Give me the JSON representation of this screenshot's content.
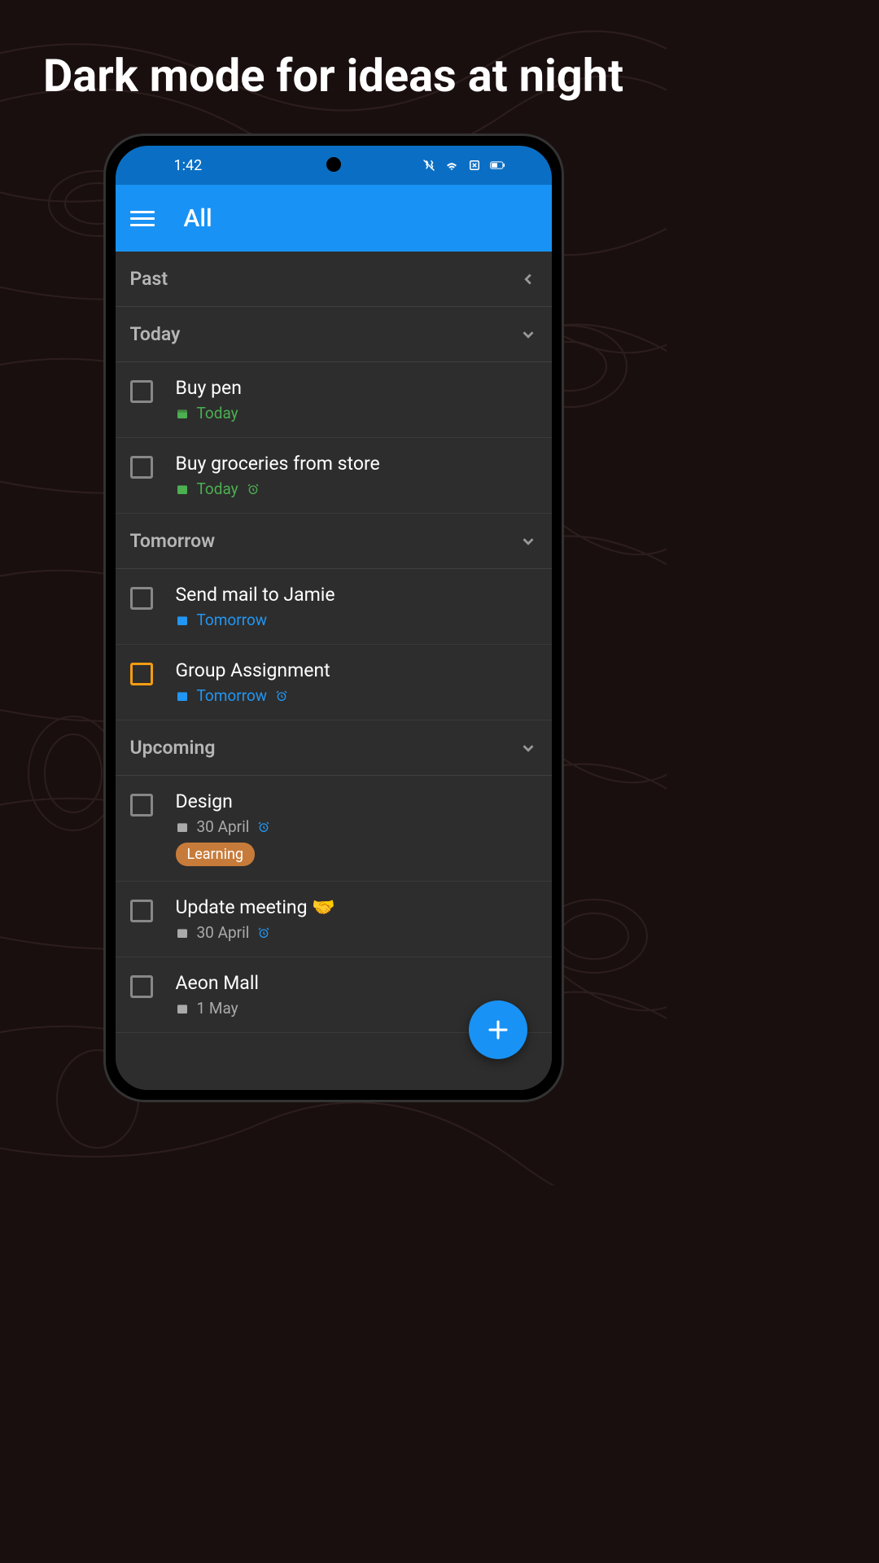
{
  "headline": "Dark mode for ideas at night",
  "status_bar": {
    "time": "1:42"
  },
  "app_bar": {
    "title": "All"
  },
  "sections": {
    "past": {
      "label": "Past"
    },
    "today": {
      "label": "Today",
      "items": [
        {
          "title": "Buy pen",
          "date": "Today",
          "has_alarm": false
        },
        {
          "title": "Buy groceries from store",
          "date": "Today",
          "has_alarm": true
        }
      ]
    },
    "tomorrow": {
      "label": "Tomorrow",
      "items": [
        {
          "title": "Send mail to Jamie",
          "date": "Tomorrow",
          "has_alarm": false
        },
        {
          "title": "Group Assignment",
          "date": "Tomorrow",
          "has_alarm": true,
          "priority": true
        }
      ]
    },
    "upcoming": {
      "label": "Upcoming",
      "items": [
        {
          "title": "Design",
          "date": "30 April",
          "has_alarm": true,
          "tag": "Learning"
        },
        {
          "title": "Update meeting 🤝",
          "date": "30 April",
          "has_alarm": true
        },
        {
          "title": "Aeon Mall",
          "date": "1 May",
          "has_alarm": false
        }
      ]
    }
  }
}
